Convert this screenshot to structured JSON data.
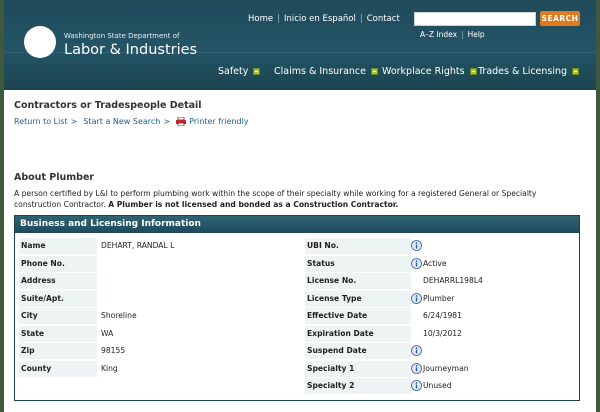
{
  "header": {
    "agency_small": "Washington State Department of",
    "agency_big": "Labor & Industries",
    "toplinks": [
      "Home",
      "Inicio en Español",
      "Contact"
    ],
    "search_placeholder": "",
    "search_button": "SEARCH",
    "sublinks": [
      "A–Z Index",
      "Help"
    ],
    "nav": [
      "Safety",
      "Claims & Insurance",
      "Workplace Rights",
      "Trades & Licensing"
    ],
    "colors": {
      "header_bg": "#1f4a5a",
      "search_button": "#e07a1d",
      "nav_bullet": "#a4c93a"
    }
  },
  "page": {
    "title": "Contractors or Tradespeople Detail",
    "breadcrumbs": {
      "return": "Return to List",
      "search": "Start a New Search",
      "printer": "Printer friendly"
    }
  },
  "about": {
    "title": "About Plumber",
    "text": "A person certified by L&I to perform plumbing work within the scope of their specialty while working for a registered General or Specialty construction Contractor.",
    "bold_text": "A Plumber is not licensed and bonded as a Construction Contractor."
  },
  "business": {
    "header": "Business and Licensing Information",
    "left": [
      {
        "label": "Name",
        "value": "DEHART, RANDAL L"
      },
      {
        "label": "Phone No.",
        "value": ""
      },
      {
        "label": "Address",
        "value": ""
      },
      {
        "label": "Suite/Apt.",
        "value": ""
      },
      {
        "label": "City",
        "value": "Shoreline"
      },
      {
        "label": "State",
        "value": "WA"
      },
      {
        "label": "Zip",
        "value": "98155"
      },
      {
        "label": "County",
        "value": "King"
      }
    ],
    "right": [
      {
        "label": "UBI No.",
        "value": "",
        "info_icon": true
      },
      {
        "label": "Status",
        "value": "Active",
        "info_icon": true
      },
      {
        "label": "License No.",
        "value": "DEHARRL198L4",
        "info_icon": false
      },
      {
        "label": "License Type",
        "value": "Plumber",
        "info_icon": true
      },
      {
        "label": "Effective Date",
        "value": "6/24/1981",
        "info_icon": false
      },
      {
        "label": "Expiration Date",
        "value": "10/3/2012",
        "info_icon": false
      },
      {
        "label": "Suspend Date",
        "value": "",
        "info_icon": true
      },
      {
        "label": "Specialty 1",
        "value": "Journeyman",
        "info_icon": true
      },
      {
        "label": "Specialty 2",
        "value": "Unused",
        "info_icon": true
      }
    ]
  }
}
